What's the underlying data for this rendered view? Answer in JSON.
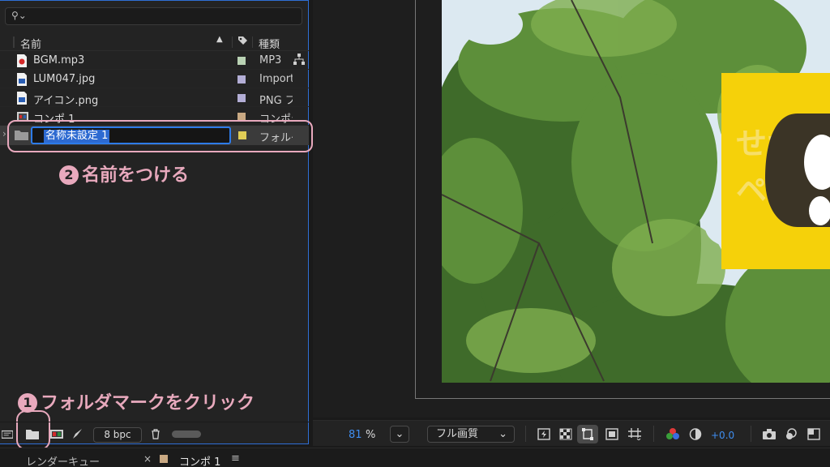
{
  "project": {
    "columns": {
      "name": "名前",
      "type": "種類"
    },
    "items": [
      {
        "name": "BGM.mp3",
        "type": "MP3",
        "icon": "audio-file-icon",
        "label_color": "#b9d2b4"
      },
      {
        "name": "LUM047.jpg",
        "type": "Import",
        "icon": "image-file-icon",
        "label_color": "#b3aed6"
      },
      {
        "name": "アイコン.png",
        "type": "PNG フ",
        "icon": "png-file-icon",
        "label_color": "#b3aed6"
      },
      {
        "name": "コンポ 1",
        "type": "コンポジ",
        "icon": "composition-icon",
        "label_color": "#c9a983"
      }
    ],
    "new_folder": {
      "name": "名称未設定 1",
      "type": "フォルダ",
      "label_color": "#e0cd56"
    },
    "toolbar": {
      "bit_depth": "8 bpc"
    }
  },
  "annotations": {
    "step1": {
      "number": "1",
      "text": "フォルダマークをクリック"
    },
    "step2": {
      "number": "2",
      "text": "名前をつける"
    }
  },
  "viewer": {
    "zoom_value": "81",
    "zoom_unit": "%",
    "resolution": "フル画質",
    "exposure": "+0.0"
  },
  "tabs": {
    "render_queue": "レンダーキュー",
    "close": "×",
    "comp": "コンポ 1",
    "menu": "≡"
  },
  "colors": {
    "accent": "#2d7be8",
    "annotation": "#e8a9bd",
    "highlight_value": "#3f8ef0"
  }
}
